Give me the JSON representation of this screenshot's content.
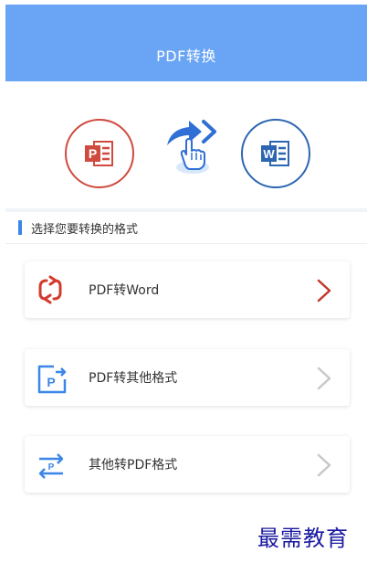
{
  "header": {
    "title": "PDF转换"
  },
  "hero": {
    "left_icon": "ppt-file-icon",
    "center_icon": "convert-arrow-hand-icon",
    "right_icon": "word-file-icon"
  },
  "section": {
    "title": "选择您要转换的格式"
  },
  "options": [
    {
      "label": "PDF转Word",
      "icon": "refresh-convert-icon",
      "chevron_color": "#c0392b"
    },
    {
      "label": "PDF转其他格式",
      "icon": "export-p-icon",
      "chevron_color": "#c8c8c8"
    },
    {
      "label": "其他转PDF格式",
      "icon": "swap-p-icon",
      "chevron_color": "#c8c8c8"
    }
  ],
  "watermark": "最需教育",
  "colors": {
    "header_bg": "#6aa4f5",
    "ppt_red": "#cf4b3e",
    "word_blue": "#2c66b1",
    "accent_blue": "#3b86e8"
  }
}
